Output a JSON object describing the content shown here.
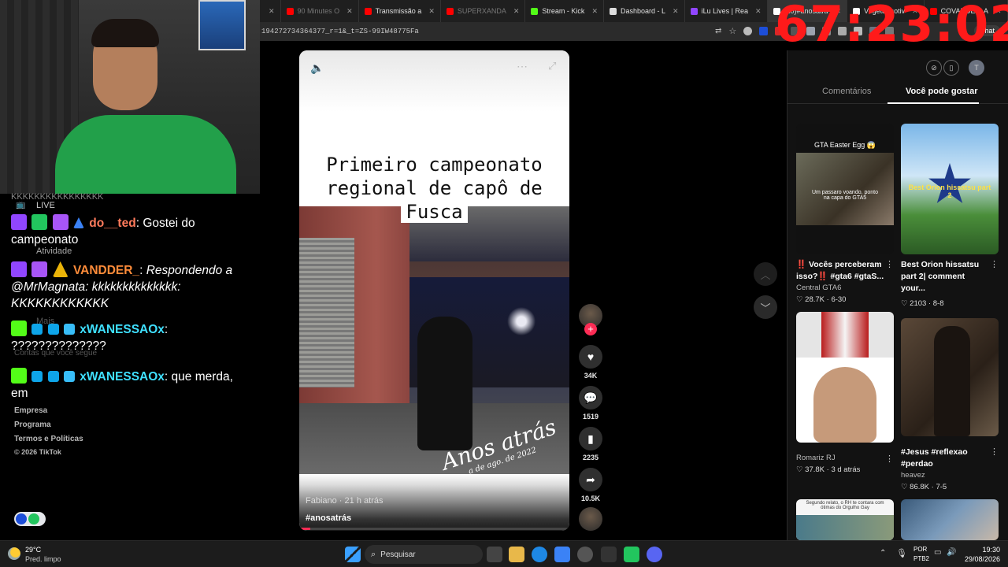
{
  "browser": {
    "tabs": [
      {
        "label": "90 Minutes O",
        "color": "#ff0000",
        "dim": true
      },
      {
        "label": "Transmissão a",
        "color": "#ff0000",
        "dim": false
      },
      {
        "label": "SUPERXANDA",
        "color": "#ff0000",
        "dim": true
      },
      {
        "label": "Stream - Kick",
        "color": "#53fc18",
        "dim": false
      },
      {
        "label": "Dashboard - L",
        "color": "#dddddd",
        "dim": false
      },
      {
        "label": "iLu Lives | Rea",
        "color": "#9146ff",
        "dim": false
      },
      {
        "label": "(10)#anosatrá",
        "color": "#ffffff",
        "dim": false,
        "active": true
      },
      {
        "label": "Vegeta motiv",
        "color": "#ffffff",
        "dim": false
      },
      {
        "label": "COVARDES! A",
        "color": "#ff0000",
        "dim": false
      }
    ],
    "url": "194272734364377_r=1&_t=ZS-99IW48775Fa",
    "chat_label": "Chat",
    "profile_initial": "T"
  },
  "overlay": {
    "timer": "67:23:02"
  },
  "sidebar": {
    "items": [
      "LIVE",
      "Atividade",
      "Mais",
      "Contas que você segue",
      "Empresa",
      "Programa",
      "Termos e Políticas",
      "© 2026 TikTok"
    ],
    "top_text": "KKKKKKKKKKKKKKKK"
  },
  "chat": [
    {
      "user": "do__ted",
      "color": "#ff7b5c",
      "message": "Gostei do campeonato",
      "italic": false
    },
    {
      "user": "VANDDER_",
      "color": "#ff8c3a",
      "message": "Respondendo a @MrMagnata: kkkkkkkkkkkkkk: KKKKKKKKKKKK",
      "italic": true
    },
    {
      "user": "xWANESSAOx",
      "color": "#3fe0ff",
      "message": "??????????????",
      "italic": false
    },
    {
      "user": "xWANESSAOx",
      "color": "#3fe0ff",
      "message": "que merda, em",
      "italic": false
    }
  ],
  "video": {
    "caption_lines": [
      "Primeiro campeonato",
      "regional de capô de",
      "Fusca"
    ],
    "script_main": "Anos atrás",
    "script_date": "a de ago. de 2022",
    "author_line": "Fabiano · 21 h atrás",
    "hashtag": "#anosatrás",
    "progress": 0.04
  },
  "actions": {
    "likes": "34K",
    "comments": "1519",
    "saves": "2235",
    "shares": "10.5K"
  },
  "right_panel": {
    "tabs": [
      "Comentários",
      "Você pode gostar"
    ],
    "active_tab": 1,
    "cards": [
      {
        "title": "‼️ Vocês perceberam isso?‼️ #gta6 #gtaS...",
        "author": "Central GTA6",
        "likes": "28.7K",
        "date": "6-30",
        "thumb_label": "GTA Easter Egg 😱",
        "thumb_sub": "Um passaro voando, ponto na capa do GTA5"
      },
      {
        "title": "Best Orion hissatsu part 2| comment your...",
        "author": "",
        "likes": "2103",
        "date": "8-8",
        "thumb_label": "Best Orion hissatsu part 2",
        "thumb_sub": ""
      },
      {
        "title": "",
        "author": "Romariz RJ",
        "likes": "37.8K",
        "date": "3 d atrás",
        "thumb_label": "",
        "thumb_sub": ""
      },
      {
        "title": "#Jesus #reflexao #perdao",
        "author": "heavez",
        "likes": "86.8K",
        "date": "7-5",
        "thumb_label": "",
        "thumb_sub": ""
      },
      {
        "title": "",
        "author": "",
        "likes": "",
        "date": "",
        "thumb_label": "Segundo relato, o RH te contara com ótimas do Orgulho Gay",
        "thumb_sub": ""
      }
    ]
  },
  "taskbar": {
    "temp": "29°C",
    "weather": "Pred. limpo",
    "search": "Pesquisar",
    "lang1": "POR",
    "lang2": "PTB2",
    "time": "19:30",
    "date": "29/08/2026"
  }
}
